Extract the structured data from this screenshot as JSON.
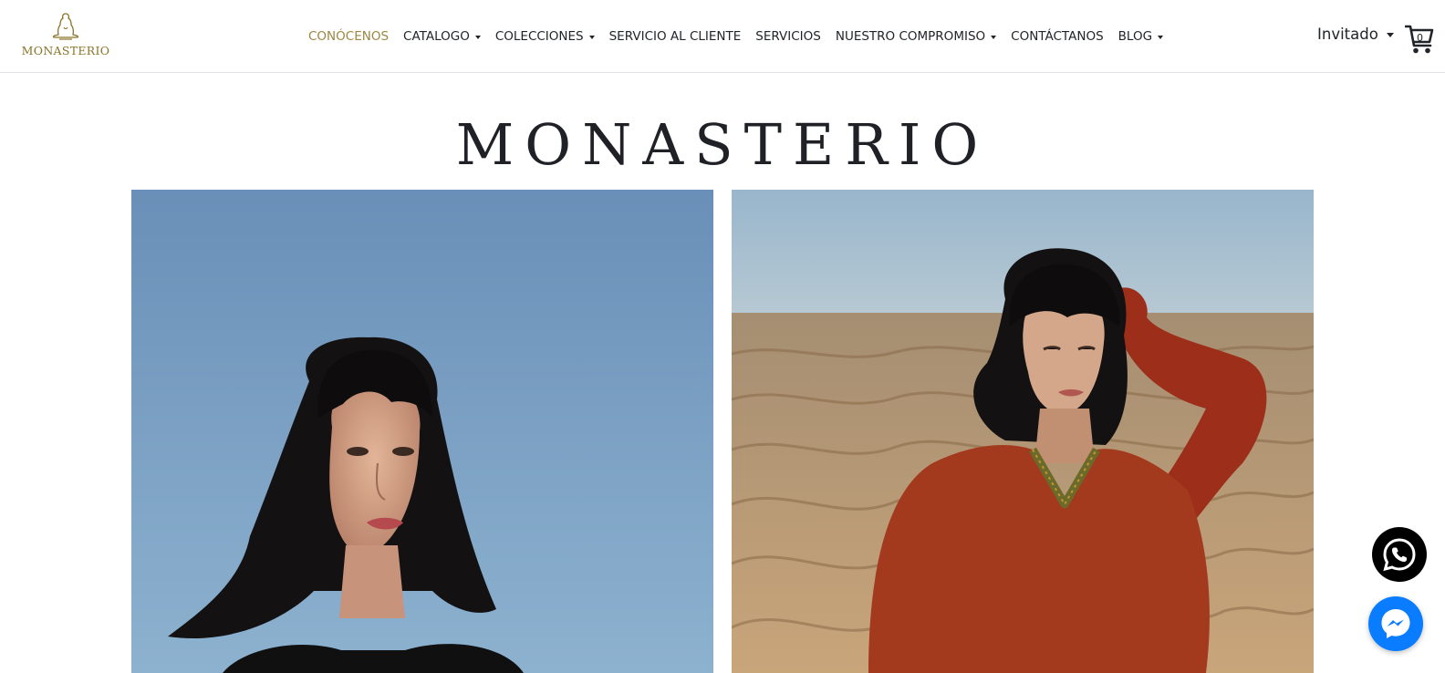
{
  "brand": {
    "logo_text": "MONASTERIO",
    "logo_icon": "monk-silhouette-icon",
    "logo_color": "#8a7428"
  },
  "nav": {
    "items": [
      {
        "label": "CONÓCENOS",
        "active": true,
        "dropdown": false
      },
      {
        "label": "CATALOGO",
        "active": false,
        "dropdown": true
      },
      {
        "label": "COLECCIONES",
        "active": false,
        "dropdown": true
      },
      {
        "label": "SERVICIO AL CLIENTE",
        "active": false,
        "dropdown": false
      },
      {
        "label": "SERVICIOS",
        "active": false,
        "dropdown": false
      },
      {
        "label": "NUESTRO COMPROMISO",
        "active": false,
        "dropdown": true
      },
      {
        "label": "CONTÁCTANOS",
        "active": false,
        "dropdown": false
      },
      {
        "label": "BLOG",
        "active": false,
        "dropdown": true
      }
    ],
    "active_color": "#9c8641"
  },
  "user": {
    "label": "Invitado"
  },
  "cart": {
    "icon": "shopping-cart-icon",
    "count": "0"
  },
  "hero": {
    "title": "MONASTERIO",
    "photos": [
      {
        "subject": "woman-portrait-blue-sky"
      },
      {
        "subject": "woman-red-sweater-desert-dunes"
      }
    ]
  },
  "floating": {
    "whatsapp_icon": "whatsapp-icon",
    "messenger_icon": "messenger-icon",
    "whatsapp_color": "#000000",
    "messenger_color": "#0a7cff"
  }
}
